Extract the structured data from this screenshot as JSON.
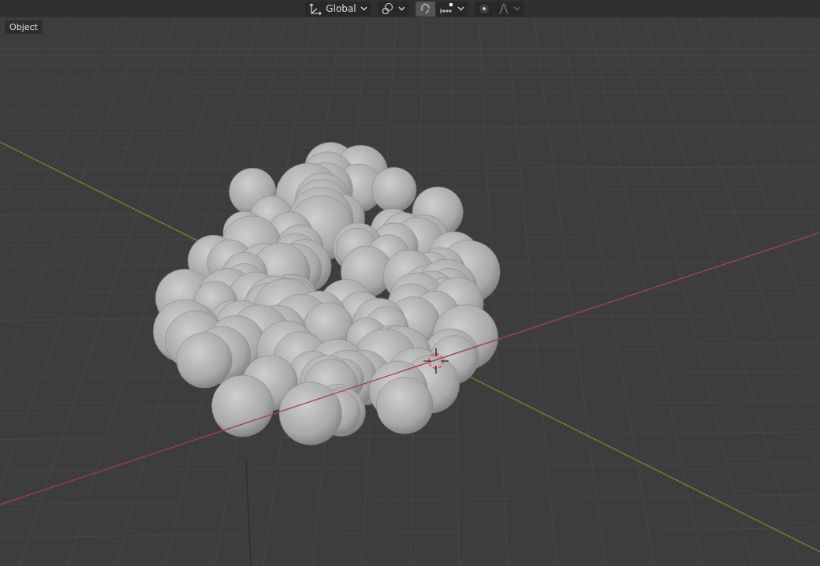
{
  "header": {
    "orientation": {
      "label": "Global"
    },
    "snap": {
      "on": true
    },
    "proportional_editing": {
      "on": false
    },
    "falloff": {
      "disabled": true
    }
  },
  "viewport": {
    "mode_label": "Object"
  }
}
